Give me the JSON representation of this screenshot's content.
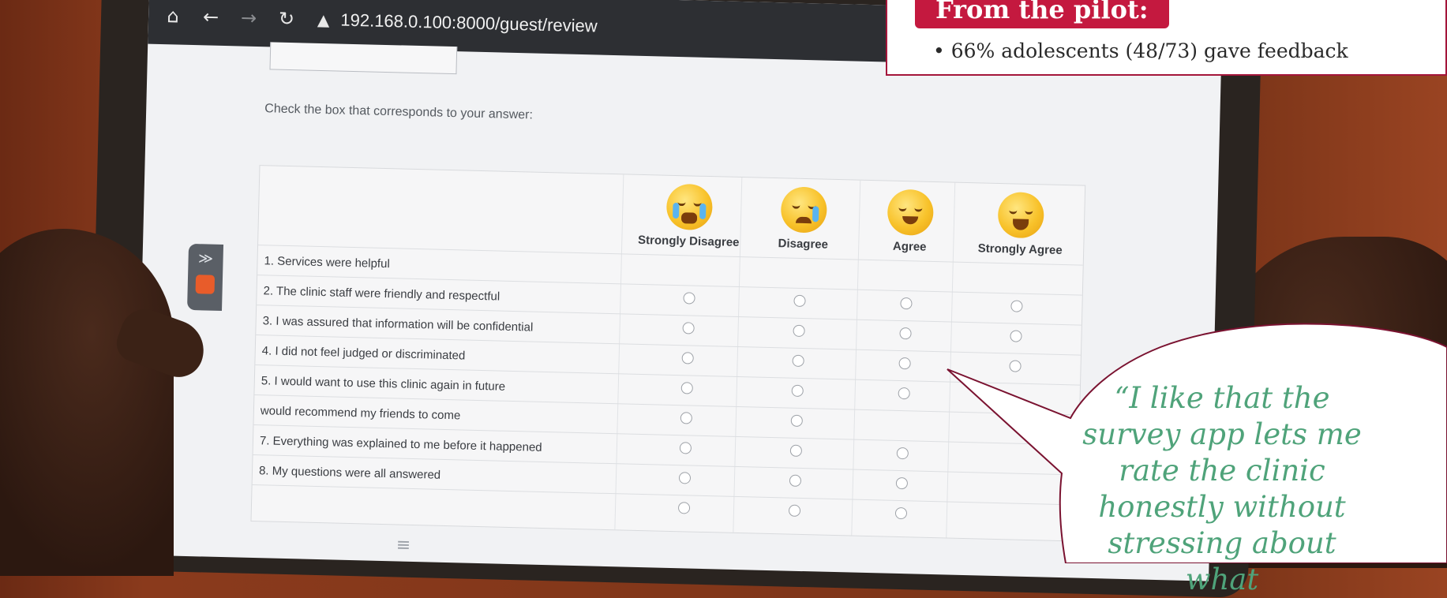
{
  "browser": {
    "url": "192.168.0.100:8000/guest/review",
    "icons": [
      "home-icon",
      "back-arrow-icon",
      "forward-arrow-icon",
      "reload-icon",
      "warning-icon"
    ]
  },
  "survey": {
    "instruction": "Check the box that corresponds to your answer:",
    "scale": [
      {
        "label": "Strongly Disagree",
        "emoji": "loudly-crying-face"
      },
      {
        "label": "Disagree",
        "emoji": "sad-face"
      },
      {
        "label": "Agree",
        "emoji": "smiling-face"
      },
      {
        "label": "Strongly Agree",
        "emoji": "grinning-face"
      }
    ],
    "questions": [
      "1. Services were helpful",
      "2. The clinic staff were friendly and respectful",
      "3. I was assured that information will be confidential",
      "4. I did not feel judged or discriminated",
      "5. I would want to use this clinic again in future",
      "would recommend my friends to come",
      "7. Everything was explained to me before it happened",
      "8. My questions were all answered"
    ]
  },
  "callout": {
    "title": "From the pilot:",
    "bullet": "• 66% adolescents (48/73) gave feedback",
    "accent_color": "#c4193f"
  },
  "quote": {
    "line1": "“I like that the",
    "line2": "survey app lets me",
    "line3": "rate the clinic",
    "line4": "honestly without",
    "line5": "stressing about what",
    "text_color": "#4fa37a"
  }
}
